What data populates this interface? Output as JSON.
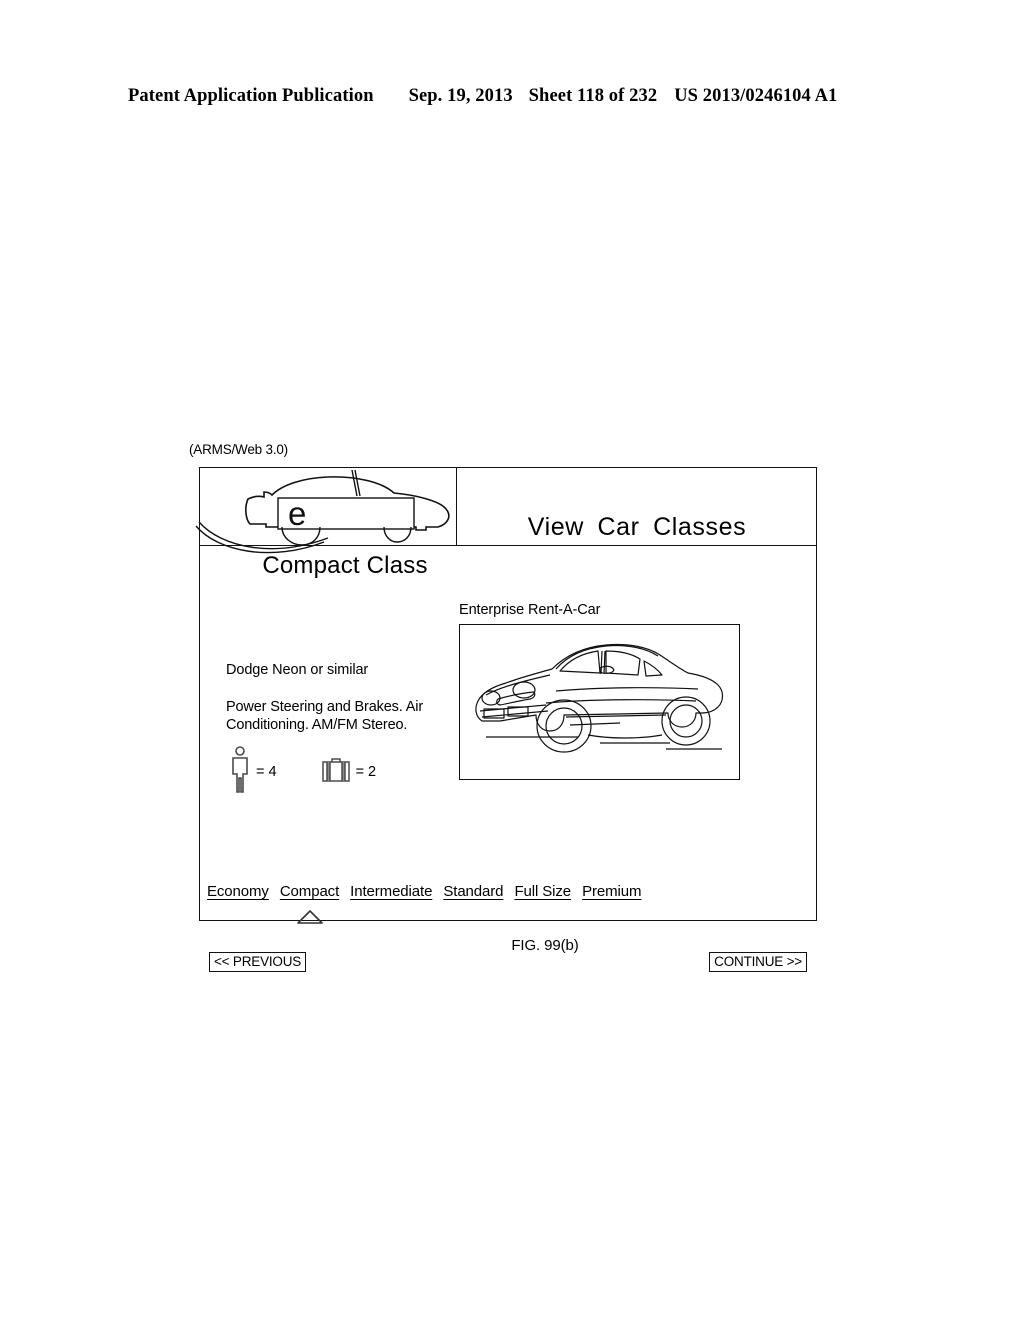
{
  "patent_header": {
    "publication": "Patent Application Publication",
    "date": "Sep. 19, 2013",
    "sheet": "Sheet 118 of 232",
    "number": "US 2013/0246104 A1"
  },
  "figure": {
    "caption": "FIG. 99(b)",
    "system_label": "(ARMS/Web 3.0)"
  },
  "screen": {
    "logo": {
      "letter": "e",
      "alt": "enterprise-logo"
    },
    "title": "View  Car  Classes",
    "class_heading": "Compact Class",
    "vendor": "Enterprise Rent-A-Car",
    "model": "Dodge Neon or similar",
    "features": "Power Steering and Brakes. Air Conditioning. AM/FM Stereo.",
    "capacity": {
      "passengers_label": "= 4",
      "passengers_icon": "person-icon",
      "luggage_label": "= 2",
      "luggage_icon": "suitcase-icon"
    },
    "class_links": [
      {
        "label": "Economy",
        "selected": false
      },
      {
        "label": "Compact",
        "selected": true
      },
      {
        "label": "Intermediate",
        "selected": false
      },
      {
        "label": "Standard",
        "selected": false
      },
      {
        "label": "Full Size",
        "selected": false
      },
      {
        "label": "Premium",
        "selected": false
      }
    ],
    "buttons": {
      "previous": "<< PREVIOUS",
      "continue": "CONTINUE >>"
    }
  },
  "colors": {
    "ink": "#000000",
    "page": "#ffffff"
  }
}
